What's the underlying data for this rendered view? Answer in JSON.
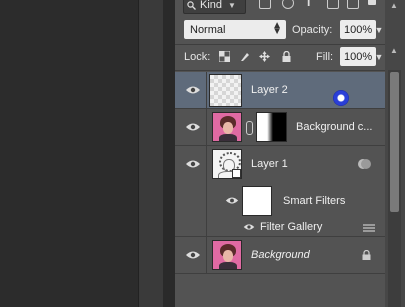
{
  "toolbar": {
    "kind_label": "Kind",
    "blend_mode": "Normal",
    "opacity_label": "Opacity:",
    "opacity_value": "100%",
    "lock_label": "Lock:",
    "fill_label": "Fill:",
    "fill_value": "100%"
  },
  "layers": [
    {
      "name": "Layer 2",
      "selected": true
    },
    {
      "name": "Background c..."
    },
    {
      "name": "Layer 1"
    },
    {
      "name": "Smart Filters"
    },
    {
      "name": "Filter Gallery"
    },
    {
      "name": "Background"
    }
  ],
  "colors": {
    "panel": "#535353",
    "selection": "#5f6b7b",
    "cursor": "#2a3fd8"
  }
}
